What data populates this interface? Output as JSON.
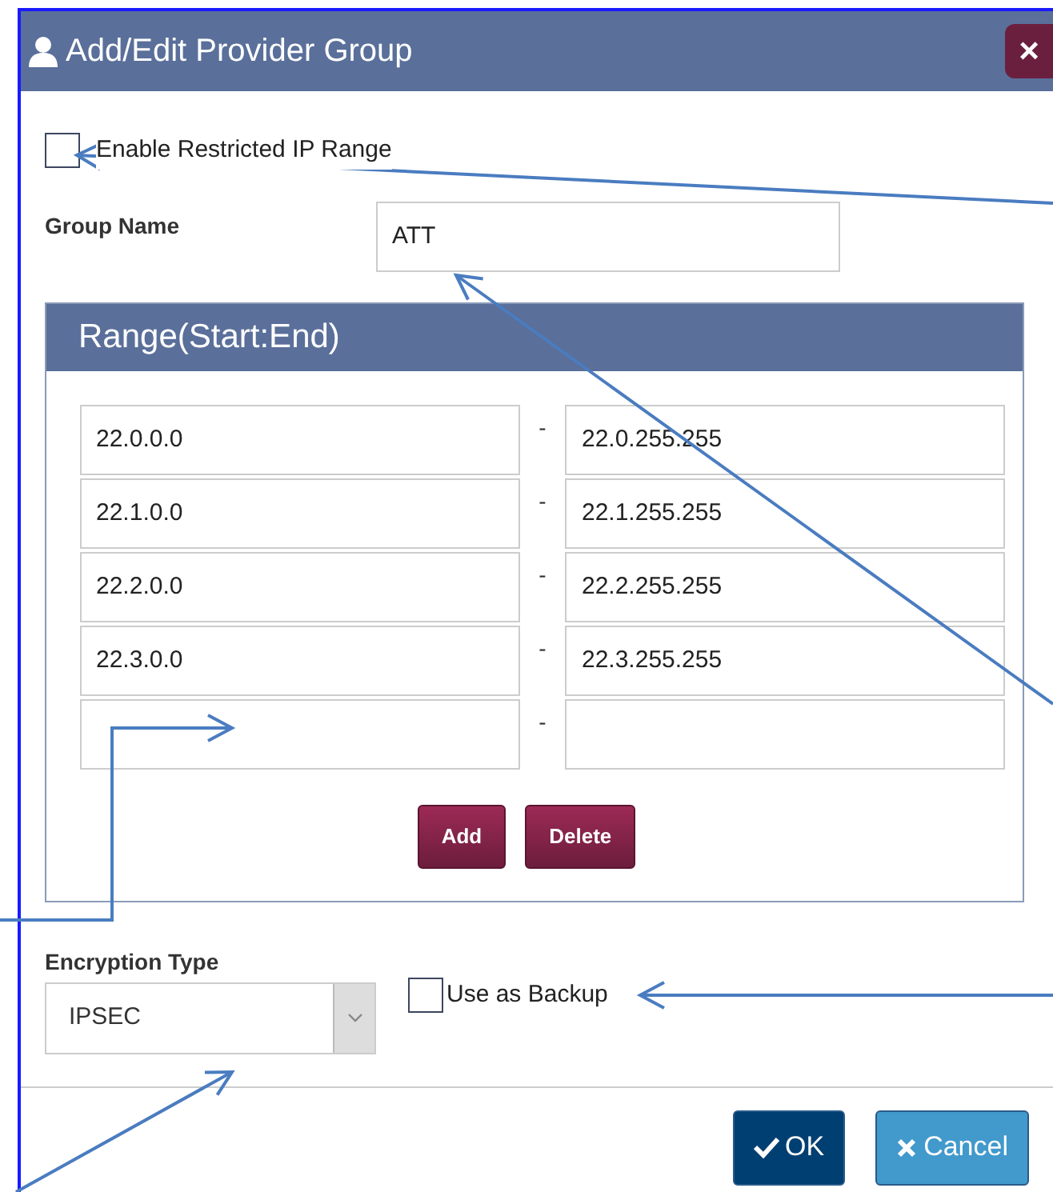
{
  "dialog": {
    "title": "Add/Edit Provider Group",
    "close": "×"
  },
  "enable_restricted_ip_range": {
    "label": "Enable Restricted IP Range",
    "checked": false
  },
  "group_name": {
    "label": "Group Name",
    "value": "ATT"
  },
  "range_panel": {
    "title": "Range(Start:End)",
    "rows": [
      {
        "start": "22.0.0.0",
        "separator": "-",
        "end": "22.0.255.255"
      },
      {
        "start": "22.1.0.0",
        "separator": "-",
        "end": "22.1.255.255"
      },
      {
        "start": "22.2.0.0",
        "separator": "-",
        "end": "22.2.255.255"
      },
      {
        "start": "22.3.0.0",
        "separator": "-",
        "end": "22.3.255.255"
      },
      {
        "separator": "-"
      }
    ],
    "buttons": [
      "Add",
      "Delete"
    ]
  },
  "encryption_type": {
    "label": "Encryption Type",
    "value": "IPSEC"
  },
  "use_as_backup": {
    "label": "Use as Backup",
    "checked": false
  },
  "footer_buttons": [
    {
      "label": "OK",
      "kind": "primary"
    },
    {
      "label": "Cancel",
      "kind": "secondary"
    }
  ]
}
